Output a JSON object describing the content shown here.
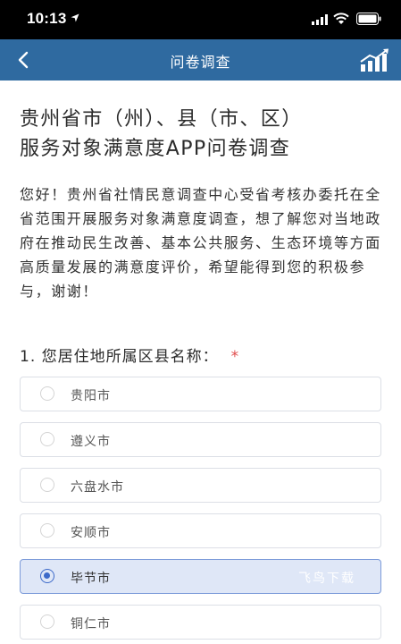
{
  "status_bar": {
    "time": "10:13",
    "icons": [
      "location-arrow-icon",
      "signal-icon",
      "wifi-icon",
      "battery-icon"
    ]
  },
  "nav": {
    "back_icon": "chevron-left-icon",
    "title": "问卷调查",
    "stats_icon": "trend-chart-icon"
  },
  "survey": {
    "title_line1": "贵州省市（州）、县（市、区）",
    "title_line2": "服务对象满意度APP问卷调查",
    "intro": "您好！贵州省社情民意调查中心受省考核办委托在全省范围开展服务对象满意度调查，想了解您对当地政府在推动民生改善、基本公共服务、生态环境等方面高质量发展的满意度评价，希望能得到您的积极参与，谢谢！"
  },
  "question": {
    "text": "1. 您居住地所属区县名称：",
    "required_mark": "*",
    "options": [
      {
        "label": "贵阳市",
        "selected": false
      },
      {
        "label": "遵义市",
        "selected": false
      },
      {
        "label": "六盘水市",
        "selected": false
      },
      {
        "label": "安顺市",
        "selected": false
      },
      {
        "label": "毕节市",
        "selected": true
      },
      {
        "label": "铜仁市",
        "selected": false
      }
    ]
  },
  "watermark": "飞鸟下载",
  "colors": {
    "nav_bar": "#2f6aa0",
    "selected_bg": "#dfe7f7",
    "selected_radio": "#3d6ac9",
    "required": "#e04b4b"
  }
}
